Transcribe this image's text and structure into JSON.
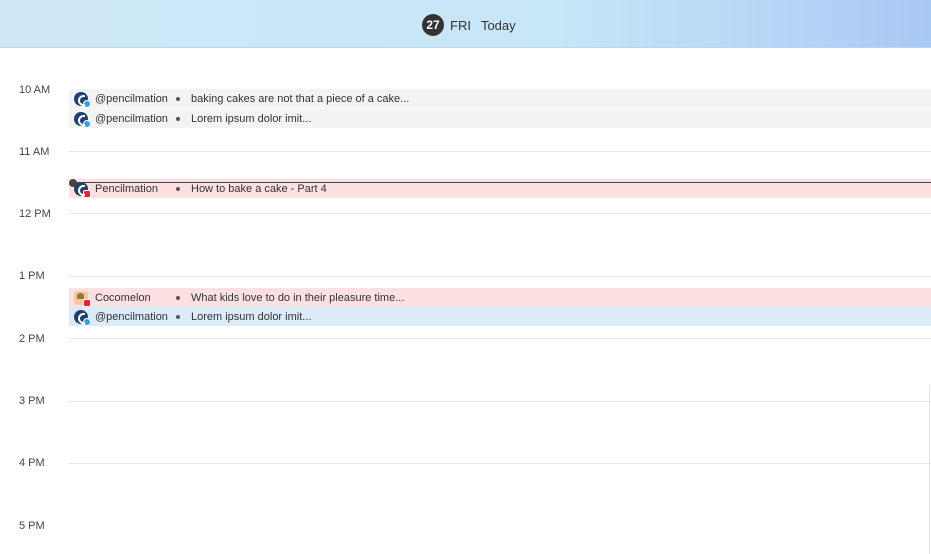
{
  "header": {
    "day_number": "27",
    "day_of_week": "FRI",
    "today_label": "Today"
  },
  "hours": [
    "10 AM",
    "11 AM",
    "12 PM",
    "1 PM",
    "2 PM",
    "3 PM",
    "4 PM",
    "5 PM"
  ],
  "events": [
    {
      "channel": "@pencilmation",
      "title": "baking cakes are not that a piece of a cake...",
      "color": "#f3f3f3",
      "platform": "twitter"
    },
    {
      "channel": "@pencilmation",
      "title": "Lorem ipsum dolor imit...",
      "color": "#f3f3f3",
      "platform": "twitter"
    },
    {
      "channel": "Pencilmation",
      "title": "How to bake a cake - Part 4",
      "color": "#fde0e2",
      "platform": "youtube"
    },
    {
      "channel": "Cocomelon",
      "title": "What kids love to do in their pleasure time...",
      "color": "#fde0e2",
      "platform": "youtube"
    },
    {
      "channel": "@pencilmation",
      "title": "Lorem ipsum dolor imit...",
      "color": "#dcebf8",
      "platform": "twitter"
    }
  ],
  "colors": {
    "header_gradient_start": "#cfe8f7",
    "header_gradient_end": "#a9c9f5",
    "now_indicator": "#444444"
  }
}
